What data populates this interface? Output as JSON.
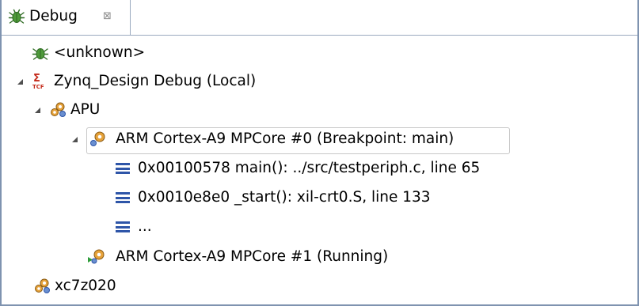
{
  "tab": {
    "label": "Debug",
    "close_glyph": "⊠"
  },
  "tree": {
    "unknown_label": "<unknown>",
    "launch_label": "Zynq_Design Debug (Local)",
    "apu_label": "APU",
    "core0_label": "ARM Cortex-A9 MPCore #0 (Breakpoint: main)",
    "frames": [
      "0x00100578 main(): ../src/testperiph.c, line 65",
      "0x0010e8e0 _start(): xil-crt0.S, line 133",
      "..."
    ],
    "core1_label": "ARM Cortex-A9 MPCore #1 (Running)",
    "device_label": "xc7z020"
  },
  "icons": {
    "tab": "bug-icon",
    "unknown": "bug-icon",
    "launch": "tcf-launch-icon",
    "apu": "processor-group-icon",
    "core0": "suspended-core-icon",
    "frame": "stack-frame-icon",
    "core1": "running-core-icon",
    "device": "device-icon"
  },
  "colors": {
    "border": "#7f93b0",
    "twisty": "#4f4f4f",
    "running": "#2e9c3a",
    "frame_glyph": "#2e55a8",
    "launch_red": "#c42a1a"
  }
}
